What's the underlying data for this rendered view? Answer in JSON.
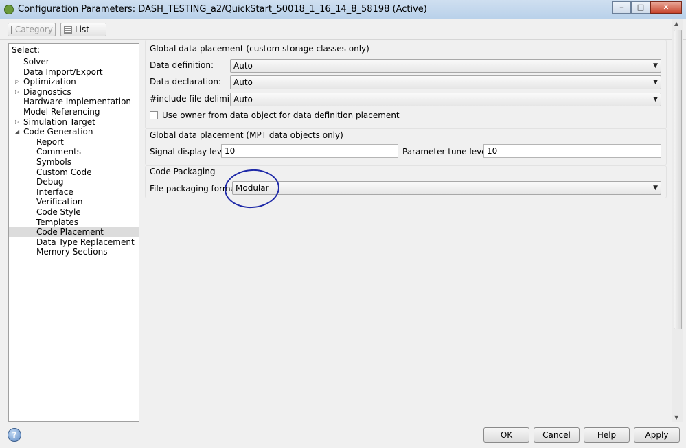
{
  "window": {
    "title": "Configuration Parameters: DASH_TESTING_a2/QuickStart_50018_1_16_14_8_58198 (Active)",
    "controls": [
      "–",
      "□",
      "✕"
    ]
  },
  "toolbar": {
    "category_label": "Category",
    "list_label": "List"
  },
  "left_panel": {
    "select_label": "Select:",
    "tree": [
      {
        "label": "Solver",
        "level": 0,
        "expander": ""
      },
      {
        "label": "Data Import/Export",
        "level": 0,
        "expander": ""
      },
      {
        "label": "Optimization",
        "level": 0,
        "expander": "▷"
      },
      {
        "label": "Diagnostics",
        "level": 0,
        "expander": "▷"
      },
      {
        "label": "Hardware Implementation",
        "level": 0,
        "expander": ""
      },
      {
        "label": "Model Referencing",
        "level": 0,
        "expander": ""
      },
      {
        "label": "Simulation Target",
        "level": 0,
        "expander": "▷"
      },
      {
        "label": "Code Generation",
        "level": 0,
        "expander": "◢"
      },
      {
        "label": "Report",
        "level": 1,
        "expander": ""
      },
      {
        "label": "Comments",
        "level": 1,
        "expander": ""
      },
      {
        "label": "Symbols",
        "level": 1,
        "expander": ""
      },
      {
        "label": "Custom Code",
        "level": 1,
        "expander": ""
      },
      {
        "label": "Debug",
        "level": 1,
        "expander": ""
      },
      {
        "label": "Interface",
        "level": 1,
        "expander": ""
      },
      {
        "label": "Verification",
        "level": 1,
        "expander": ""
      },
      {
        "label": "Code Style",
        "level": 1,
        "expander": ""
      },
      {
        "label": "Templates",
        "level": 1,
        "expander": ""
      },
      {
        "label": "Code Placement",
        "level": 1,
        "expander": "",
        "selected": true
      },
      {
        "label": "Data Type Replacement",
        "level": 1,
        "expander": ""
      },
      {
        "label": "Memory Sections",
        "level": 1,
        "expander": ""
      }
    ]
  },
  "global_custom": {
    "title": "Global data placement (custom storage classes only)",
    "data_definition": {
      "label": "Data definition:",
      "value": "Auto"
    },
    "data_declaration": {
      "label": "Data declaration:",
      "value": "Auto"
    },
    "include_delimiter": {
      "label": "#include file delimiter:",
      "value": "Auto"
    },
    "use_owner": {
      "label": "Use owner from data object for data definition placement",
      "checked": false
    }
  },
  "global_mpt": {
    "title": "Global data placement (MPT data objects only)",
    "signal_display": {
      "label": "Signal display level:",
      "value": "10"
    },
    "parameter_tune": {
      "label": "Parameter tune level:",
      "value": "10"
    }
  },
  "code_packaging": {
    "title": "Code Packaging",
    "file_format": {
      "label": "File packaging format:",
      "value": "Modular"
    }
  },
  "buttons": {
    "ok": "OK",
    "cancel": "Cancel",
    "help": "Help",
    "apply": "Apply",
    "help_icon": "?"
  },
  "colors": {
    "annotation": "#1f2aa8",
    "selected_row": "#dcdcdc"
  }
}
